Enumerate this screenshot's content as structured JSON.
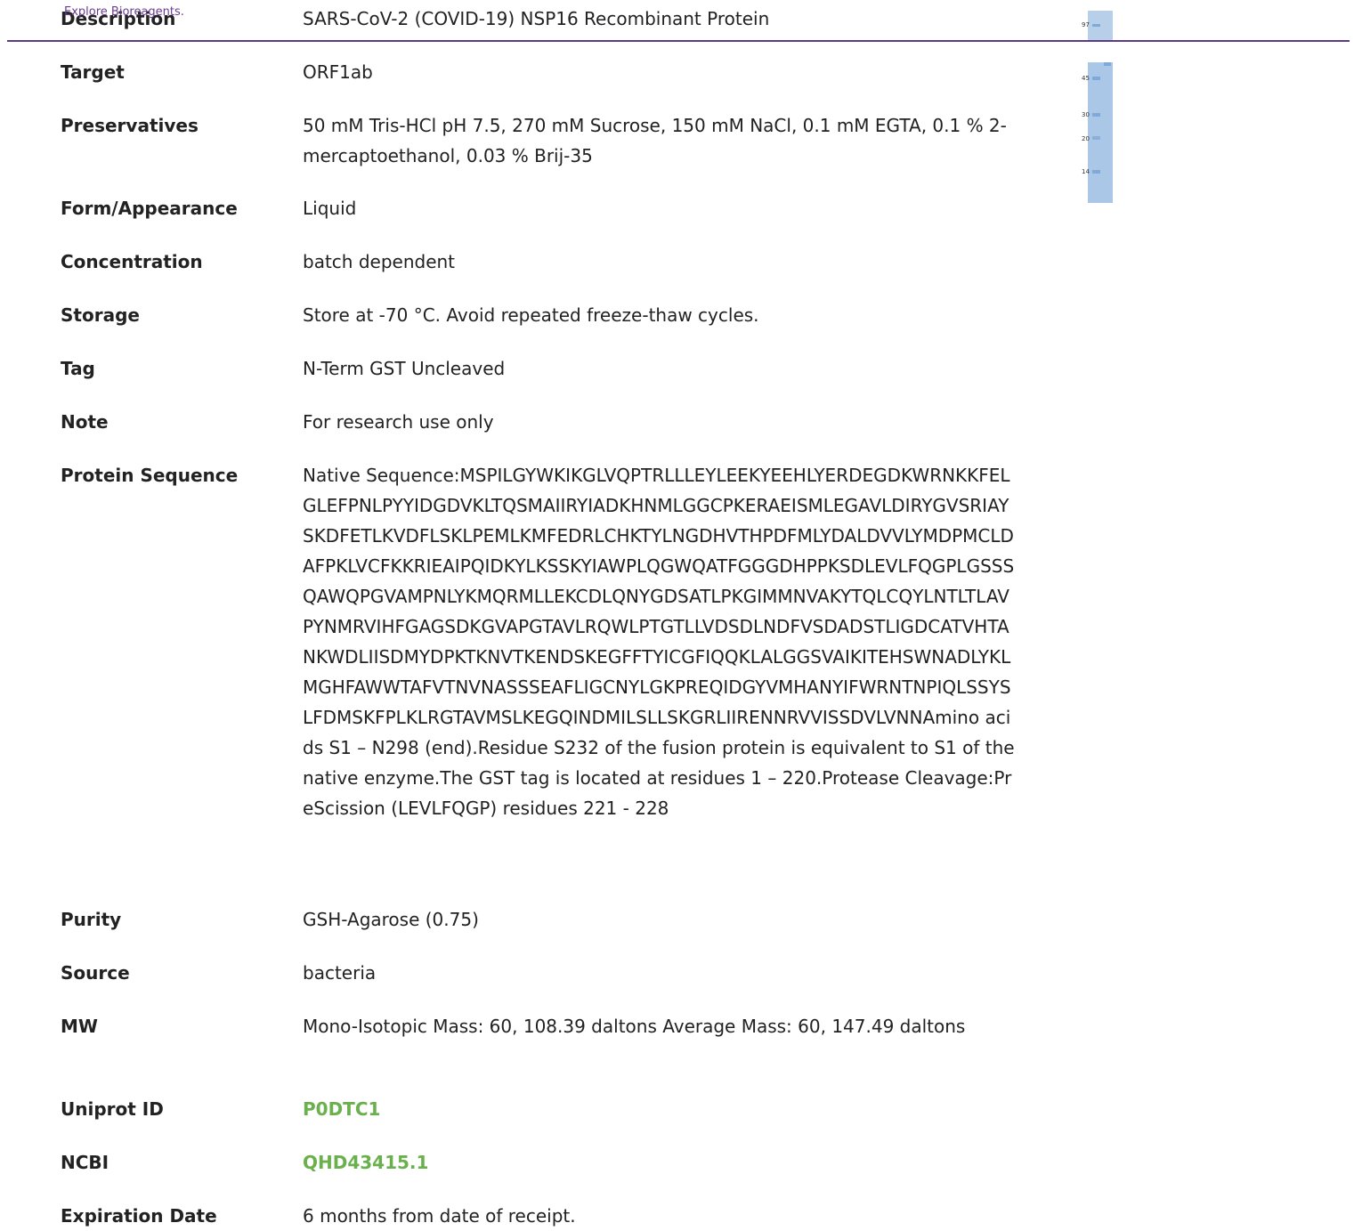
{
  "header": {
    "tagline": "Explore Bioreagents.",
    "rule_color": "#5a3b8a"
  },
  "specs": [
    {
      "label": "Description",
      "value": "SARS-CoV-2 (COVID-19) NSP16 Recombinant Protein"
    },
    {
      "label": "Target",
      "value": "ORF1ab"
    },
    {
      "label": "Preservatives",
      "value": "50 mM Tris-HCl pH 7.5, 270 mM Sucrose, 150 mM NaCl, 0.1 mM EGTA, 0.1 % 2-mercaptoethanol, 0.03 % Brij-35"
    },
    {
      "label": "Form/Appearance",
      "value": "Liquid"
    },
    {
      "label": "Concentration",
      "value": "batch dependent"
    },
    {
      "label": "Storage",
      "value": "Store at -70 °C. Avoid repeated freeze-thaw cycles."
    },
    {
      "label": "Tag",
      "value": "N-Term GST Uncleaved"
    },
    {
      "label": "Note",
      "value": "For research use only"
    },
    {
      "label": "Protein Sequence",
      "value": "Native Sequence:MSPILGYWKIKGLVQPTRLLLEYLEEKYEEHLYERDEGDKWRNKKFELGLEFPNLPYYIDGDVKLTQSMAIIRYIADKHNMLGGCPKERAEISMLEGAVLDIRYGVSRIAYSKDFETLKVDFLSKLPEMLKMFEDRLCHKTYLNGDHVTHPDFMLYDALDVVLYMDPMCLDAFPKLVCFKKRIEAIPQIDKYLKSSKYIAWPLQGWQATFGGGDHPPKSDLEVLFQGPLGSSSQAWQPGVAMPNLYKMQRMLLEKCDLQNYGDSATLPKGIMMNVAKYTQLCQYLNTLTLAVPYNMRVIHFGAGSDKGVAPGTAVLRQWLPTGTLLVDSDLNDFVSDADSTLIGDCATVHTANKWDLIISDMYDPKTKNVTKENDSKEGFFTYICGFIQQKLALGGSVAIKITEHSWNADLYKLMGHFAWWTAFVTNVNASSSEAFLIGCNYLGKPREQIDGYVMHANYIFWRNTNPIQLSSYSLFDMSKFPLKLRGTAVMSLKEGQINDMILSLLSKGRLIIRENNRVVISSDVLVNNAmino acids S1 – N298 (end).Residue S232 of the fusion protein is equivalent to S1 of the native enzyme.The GST tag is located at residues 1 – 220.Protease Cleavage:PreScission (LEVLFQGP) residues 221 - 228"
    },
    {
      "label": "Purity",
      "value": "GSH-Agarose (0.75)"
    },
    {
      "label": "Source",
      "value": "bacteria"
    },
    {
      "label": "MW",
      "value": "Mono-Isotopic Mass: 60, 108.39 daltons Average Mass: 60, 147.49 daltons"
    },
    {
      "label": "Uniprot ID",
      "value": "P0DTC1",
      "is_link": true
    },
    {
      "label": "NCBI",
      "value": "QHD43415.1",
      "is_link": true
    },
    {
      "label": "Expiration Date",
      "value": "6 months from date of receipt."
    }
  ],
  "gel": {
    "markers": [
      "97",
      "45",
      "30",
      "20",
      "14"
    ],
    "color": "#a9c6e6"
  },
  "colors": {
    "link": "#6ab04c",
    "accent": "#6a3d8f"
  }
}
